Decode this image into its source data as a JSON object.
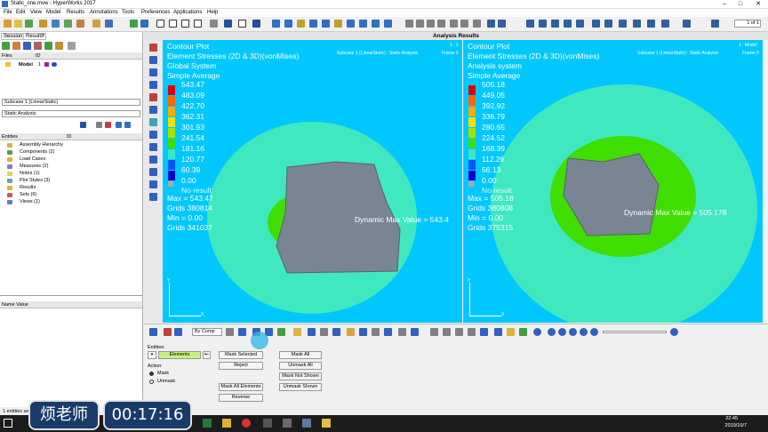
{
  "window": {
    "title": "Static_one.mvw - HyperWorks 2017",
    "minimize": "–",
    "maximize": "□",
    "close": "✕"
  },
  "menu": [
    "File",
    "Edit",
    "View",
    "Model",
    "Results",
    "Annotations",
    "Tools",
    "Preferences",
    "Applications",
    "Help"
  ],
  "toolbar": {
    "page_field": "1 of 1"
  },
  "left_panel": {
    "tab_session": "Session",
    "tab_results": "Results",
    "tab_close": "×",
    "files_header": "Files",
    "files_id_header": "ID",
    "model_item": "Model",
    "model_id": "1",
    "subcase_select": "Subcase 1 (LinearStatic)",
    "analysis_select": "Static Analysis",
    "entities_header": "Entities",
    "entities_id_header": "ID",
    "tree": [
      "Assembly Hierarchy",
      "Components (2)",
      "Load Cases",
      "Measures (2)",
      "Notes (1)",
      "Plot Styles (3)",
      "Results",
      "Sets (6)",
      "Views (1)"
    ],
    "name_value_header": "Name Value"
  },
  "viewport": {
    "header": "Analysis Results",
    "left": {
      "title_lines": [
        "Contour Plot",
        "Element Stresses (2D & 3D)(vonMises)",
        "Global System",
        "Simple Average"
      ],
      "subcase": "Subcase 1 (LinearStatic) : Static Analysis",
      "frame": "Frame 0",
      "window_id": "1 : 1",
      "legend": [
        "543.47",
        "483.09",
        "422.70",
        "362.31",
        "301.93",
        "241.54",
        "181.16",
        "120.77",
        "60.39",
        "0.00"
      ],
      "no_result": "No result",
      "stats": [
        "Max = 543.47",
        "Grids 380814",
        "Min = 0.00",
        "Grids 341037"
      ],
      "dynamic": "Dynamic Max  Value =  543.4"
    },
    "right": {
      "title_lines": [
        "Contour Plot",
        "Element Stresses (2D & 3D)(vonMises)",
        "Analysis system",
        "Simple Average"
      ],
      "subcase": "Subcase 1 (LinearStatic) : Static Analysis",
      "frame": "Frame 0",
      "window_id": "1 : Model",
      "legend": [
        "505.18",
        "449.05",
        "392.92",
        "336.79",
        "280.65",
        "224.52",
        "168.39",
        "112.26",
        "56.13",
        "0.00"
      ],
      "no_result": "No result",
      "stats": [
        "Max = 505.18",
        "Grids 380808",
        "Min = 0.00",
        "Grids 375315"
      ],
      "dynamic": "Dynamic Max  Value =  505.178"
    },
    "legend_colors": [
      "#e00000",
      "#ff6600",
      "#ffaa00",
      "#f0e000",
      "#a8e000",
      "#40dd00",
      "#00c8ff",
      "#0055ff",
      "#0000d0",
      "#0000a0"
    ],
    "axis_y": "Y",
    "axis_x": "X"
  },
  "vp_toolbar": {
    "by_comp": "By Comp"
  },
  "mask_panel": {
    "entities_label": "Entities:",
    "elements_button": "Elements",
    "action_label": "Action:",
    "mask_radio": "Mask",
    "unmask_radio": "Unmask",
    "mask_selected": "Mask Selected",
    "reject": "Reject",
    "mask_all_elements": "Mask All Elements",
    "reverse": "Reverse",
    "mask_all": "Mask All",
    "unmask_all": "Unmask All",
    "mask_not_shown": "Mask Not Shown",
    "unmask_shown": "Unmask Shown"
  },
  "status_bar": {
    "text": "1 entities sel"
  },
  "taskbar": {
    "time": "22:45",
    "date": "2019/10/7"
  },
  "overlay": {
    "name": "烦老师",
    "timer": "00:17:16"
  }
}
